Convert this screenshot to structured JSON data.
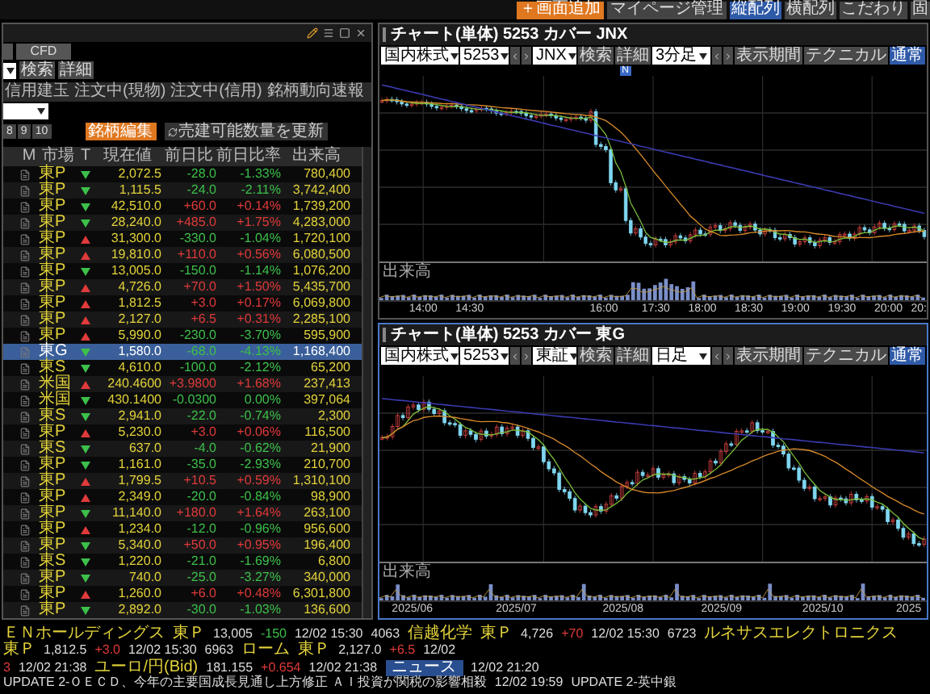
{
  "top_bar": {
    "add_button": "＋画面追加",
    "manage_button": "マイページ管理",
    "layouts": [
      {
        "label": "縦配列",
        "selected": true
      },
      {
        "label": "横配列",
        "selected": false
      },
      {
        "label": "こだわり",
        "selected": false
      },
      {
        "label": "固",
        "selected": false
      }
    ]
  },
  "watchlist": {
    "category_buttons": [
      "CFD"
    ],
    "search_button": "検索",
    "detail_button": "詳細",
    "tabs": [
      {
        "label": "信用建玉",
        "selected": false
      },
      {
        "label": "注文中(現物)",
        "selected": false
      },
      {
        "label": "注文中(信用)",
        "selected": false
      },
      {
        "label": "銘柄動向速報",
        "selected": false
      }
    ],
    "pages": [
      "8",
      "9",
      "10"
    ],
    "edit_button": "銘柄編集",
    "refresh_button": "売建可能数量を更新",
    "columns": [
      "M",
      "市場",
      "T",
      "現在値",
      "前日比",
      "前日比率",
      "出来高"
    ],
    "rows": [
      {
        "market": "東P",
        "trend_up": false,
        "price": "2,072.5",
        "change": "-28.0",
        "change_rate": "-1.33%",
        "change_up": false,
        "volume": "780,400",
        "selected": false
      },
      {
        "market": "東P",
        "trend_up": false,
        "price": "1,115.5",
        "change": "-24.0",
        "change_rate": "-2.11%",
        "change_up": false,
        "volume": "3,742,400",
        "selected": false
      },
      {
        "market": "東P",
        "trend_up": false,
        "price": "42,510.0",
        "change": "+60.0",
        "change_rate": "+0.14%",
        "change_up": true,
        "volume": "1,739,200",
        "selected": false
      },
      {
        "market": "東P",
        "trend_up": false,
        "price": "28,240.0",
        "change": "+485.0",
        "change_rate": "+1.75%",
        "change_up": true,
        "volume": "4,283,000",
        "selected": false
      },
      {
        "market": "東P",
        "trend_up": true,
        "price": "31,300.0",
        "change": "-330.0",
        "change_rate": "-1.04%",
        "change_up": false,
        "volume": "1,720,100",
        "selected": false
      },
      {
        "market": "東P",
        "trend_up": true,
        "price": "19,810.0",
        "change": "+110.0",
        "change_rate": "+0.56%",
        "change_up": true,
        "volume": "6,080,500",
        "selected": false
      },
      {
        "market": "東P",
        "trend_up": false,
        "price": "13,005.0",
        "change": "-150.0",
        "change_rate": "-1.14%",
        "change_up": false,
        "volume": "1,076,200",
        "selected": false
      },
      {
        "market": "東P",
        "trend_up": true,
        "price": "4,726.0",
        "change": "+70.0",
        "change_rate": "+1.50%",
        "change_up": true,
        "volume": "5,435,700",
        "selected": false
      },
      {
        "market": "東P",
        "trend_up": true,
        "price": "1,812.5",
        "change": "+3.0",
        "change_rate": "+0.17%",
        "change_up": true,
        "volume": "6,069,800",
        "selected": false
      },
      {
        "market": "東P",
        "trend_up": true,
        "price": "2,127.0",
        "change": "+6.5",
        "change_rate": "+0.31%",
        "change_up": true,
        "volume": "2,285,100",
        "selected": false
      },
      {
        "market": "東P",
        "trend_up": true,
        "price": "5,990.0",
        "change": "-230.0",
        "change_rate": "-3.70%",
        "change_up": false,
        "volume": "595,900",
        "selected": false
      },
      {
        "market": "東G",
        "trend_up": false,
        "price": "1,580.0",
        "change": "-68.0",
        "change_rate": "-4.13%",
        "change_up": false,
        "volume": "1,168,400",
        "selected": true
      },
      {
        "market": "東S",
        "trend_up": false,
        "price": "4,610.0",
        "change": "-100.0",
        "change_rate": "-2.12%",
        "change_up": false,
        "volume": "65,200",
        "selected": false
      },
      {
        "market": "米国",
        "trend_up": true,
        "price": "240.4600",
        "change": "+3.9800",
        "change_rate": "+1.68%",
        "change_up": true,
        "volume": "237,413",
        "selected": false
      },
      {
        "market": "米国",
        "trend_up": false,
        "price": "430.1400",
        "change": "-0.0300",
        "change_rate": "0.00%",
        "change_up": false,
        "volume": "397,064",
        "selected": false
      },
      {
        "market": "東S",
        "trend_up": false,
        "price": "2,941.0",
        "change": "-22.0",
        "change_rate": "-0.74%",
        "change_up": false,
        "volume": "2,300",
        "selected": false
      },
      {
        "market": "東P",
        "trend_up": true,
        "price": "5,230.0",
        "change": "+3.0",
        "change_rate": "+0.06%",
        "change_up": true,
        "volume": "116,500",
        "selected": false
      },
      {
        "market": "東S",
        "trend_up": false,
        "price": "637.0",
        "change": "-4.0",
        "change_rate": "-0.62%",
        "change_up": false,
        "volume": "21,900",
        "selected": false
      },
      {
        "market": "東P",
        "trend_up": false,
        "price": "1,161.0",
        "change": "-35.0",
        "change_rate": "-2.93%",
        "change_up": false,
        "volume": "210,700",
        "selected": false
      },
      {
        "market": "東P",
        "trend_up": true,
        "price": "1,799.5",
        "change": "+10.5",
        "change_rate": "+0.59%",
        "change_up": true,
        "volume": "1,310,100",
        "selected": false
      },
      {
        "market": "東P",
        "trend_up": true,
        "price": "2,349.0",
        "change": "-20.0",
        "change_rate": "-0.84%",
        "change_up": false,
        "volume": "98,900",
        "selected": false
      },
      {
        "market": "東P",
        "trend_up": false,
        "price": "11,140.0",
        "change": "+180.0",
        "change_rate": "+1.64%",
        "change_up": true,
        "volume": "263,100",
        "selected": false
      },
      {
        "market": "東P",
        "trend_up": true,
        "price": "1,234.0",
        "change": "-12.0",
        "change_rate": "-0.96%",
        "change_up": false,
        "volume": "956,600",
        "selected": false
      },
      {
        "market": "東P",
        "trend_up": false,
        "price": "5,340.0",
        "change": "+50.0",
        "change_rate": "+0.95%",
        "change_up": true,
        "volume": "196,400",
        "selected": false
      },
      {
        "market": "東S",
        "trend_up": false,
        "price": "1,220.0",
        "change": "-21.0",
        "change_rate": "-1.69%",
        "change_up": false,
        "volume": "6,800",
        "selected": false
      },
      {
        "market": "東P",
        "trend_up": false,
        "price": "740.0",
        "change": "-25.0",
        "change_rate": "-3.27%",
        "change_up": false,
        "volume": "340,000",
        "selected": false
      },
      {
        "market": "東P",
        "trend_up": true,
        "price": "1,260.0",
        "change": "+6.0",
        "change_rate": "+0.48%",
        "change_up": true,
        "volume": "6,301,800",
        "selected": false
      },
      {
        "market": "東P",
        "trend_up": false,
        "price": "2,892.0",
        "change": "-30.0",
        "change_rate": "-1.03%",
        "change_up": false,
        "volume": "136,600",
        "selected": false
      }
    ]
  },
  "charts": [
    {
      "kind": "intraday",
      "active": false,
      "title": "チャート(単体) 5253 カバー JNX",
      "market_select": "国内株式",
      "code": "5253",
      "exchange": "JNX",
      "search_button": "検索",
      "detail_button": "詳細",
      "interval": "3分足",
      "period_button": "表示期間",
      "technical_button": "テクニカル",
      "mode_button": "通常",
      "news_badge": "N",
      "volume_label": "出来高",
      "x_labels": [
        "14:00",
        "14:30",
        "16:00",
        "17:30",
        "18:00",
        "18:30",
        "19:00",
        "19:30",
        "20:00",
        "20:"
      ]
    },
    {
      "kind": "daily",
      "active": true,
      "title": "チャート(単体) 5253 カバー 東G",
      "market_select": "国内株式",
      "code": "5253",
      "exchange": "東証",
      "search_button": "検索",
      "detail_button": "詳細",
      "interval": "日足",
      "period_button": "表示期間",
      "technical_button": "テクニカル",
      "mode_button": "通常",
      "volume_label": "出来高",
      "x_labels": [
        "2025/06",
        "2025/07",
        "2025/08",
        "2025/09",
        "2025/10",
        "2025"
      ]
    }
  ],
  "ticker": [
    {
      "segments": [
        {
          "text": "ＥＮホールディングス",
          "kind": "name"
        },
        {
          "text": "東Ｐ",
          "kind": "name"
        },
        {
          "text": "13,005",
          "kind": "plain"
        },
        {
          "text": "-150",
          "kind": "down"
        },
        {
          "text": "12/02 15:30",
          "kind": "plain"
        },
        {
          "text": "4063",
          "kind": "plain"
        },
        {
          "text": "信越化学",
          "kind": "name"
        },
        {
          "text": "東Ｐ",
          "kind": "name"
        },
        {
          "text": "4,726",
          "kind": "plain"
        },
        {
          "text": "+70",
          "kind": "up"
        },
        {
          "text": "12/02 15:30",
          "kind": "plain"
        },
        {
          "text": "6723",
          "kind": "plain"
        },
        {
          "text": "ルネサスエレクトロニクス",
          "kind": "name"
        },
        {
          "text": "東Ｐ",
          "kind": "name"
        },
        {
          "text": "1,812.5",
          "kind": "plain"
        },
        {
          "text": "+3.0",
          "kind": "up"
        },
        {
          "text": "12/02 15:30",
          "kind": "plain"
        },
        {
          "text": "6963",
          "kind": "plain"
        },
        {
          "text": "ローム",
          "kind": "name"
        },
        {
          "text": "東Ｐ",
          "kind": "name"
        },
        {
          "text": "2,127.0",
          "kind": "plain"
        },
        {
          "text": "+6.5",
          "kind": "up"
        },
        {
          "text": "12/02",
          "kind": "plain"
        }
      ]
    },
    {
      "segments": [
        {
          "text": "3",
          "kind": "up"
        },
        {
          "text": "12/02 21:38",
          "kind": "plain"
        },
        {
          "text": "ユーロ/円(Bid)",
          "kind": "name"
        },
        {
          "text": "181.155",
          "kind": "plain"
        },
        {
          "text": "+0.654",
          "kind": "up"
        },
        {
          "text": "12/02 21:38",
          "kind": "plain"
        },
        {
          "text": "ニュース",
          "kind": "badge"
        },
        {
          "text": "12/02 21:20",
          "kind": "plain"
        },
        {
          "text": "UPDATE 2-ＯＥＣＤ、今年の主要国成長見通し上方修正 ＡＩ投資が関税の影響相殺",
          "kind": "plain"
        },
        {
          "text": "12/02 19:59",
          "kind": "plain"
        },
        {
          "text": "UPDATE 2-英中銀",
          "kind": "plain"
        }
      ]
    }
  ]
}
